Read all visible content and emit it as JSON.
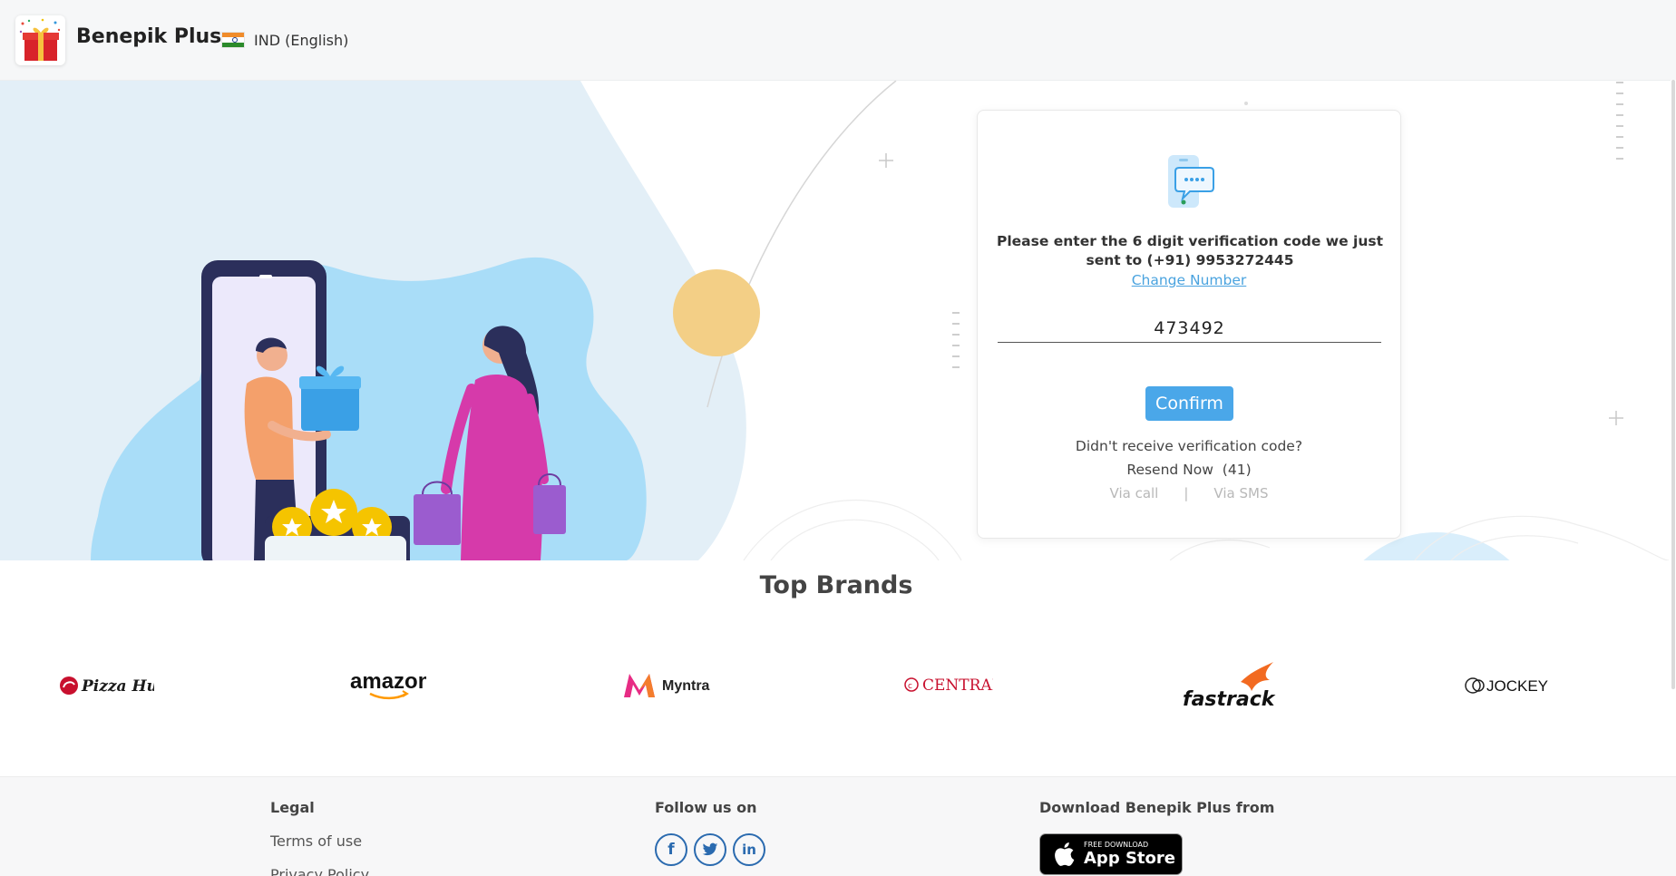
{
  "header": {
    "brand_name": "Benepik Plus",
    "language": "IND (English)",
    "logo_icon": "gift-icon",
    "flag_icon": "india-flag-icon"
  },
  "verification": {
    "icon": "chat-message-icon",
    "instruction": "Please enter the 6 digit verification code we just sent to (+91) 9953272445",
    "change_number": "Change Number",
    "code_value": "473492",
    "confirm_label": "Confirm",
    "didnt_receive": "Didn't receive verification code?",
    "resend_text": "Resend Now  (41)",
    "via_call": "Via call",
    "separator": "|",
    "via_sms": "Via SMS"
  },
  "brands": {
    "title": "Top Brands",
    "items": [
      "Pizza Hut",
      "amazon",
      "Myntra",
      "CENTRAL",
      "fastrack",
      "JOCKEY"
    ]
  },
  "footer": {
    "legal_heading": "Legal",
    "terms": "Terms of use",
    "privacy": "Privacy Policy",
    "follow_heading": "Follow us on",
    "social": [
      "facebook-icon",
      "twitter-icon",
      "linkedin-icon"
    ],
    "download_heading": "Download Benepik Plus from",
    "appstore_small": "FREE DOWNLOAD",
    "appstore_big": "App Store"
  },
  "colors": {
    "accent": "#4aa7e9",
    "link": "#4aa3df",
    "hero_blob": "#e3eff7",
    "scene_blob": "#a9ddf8",
    "sun": "#f3cf86",
    "social": "#2a6aaf"
  }
}
